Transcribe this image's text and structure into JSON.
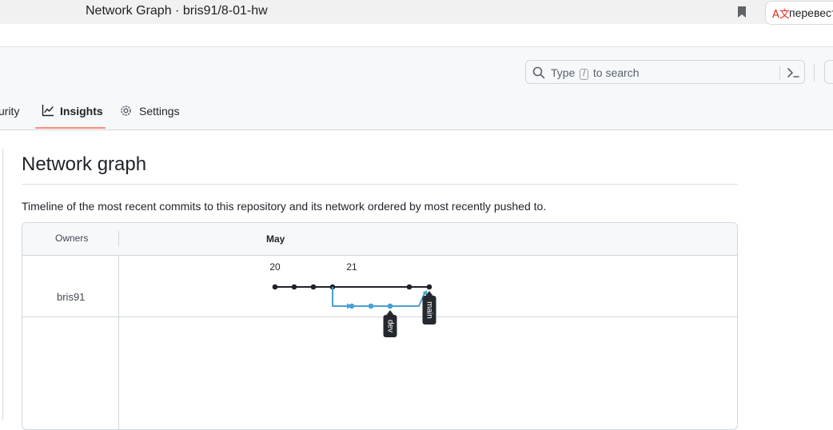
{
  "browser": {
    "tab_title": "Network Graph · bris91/8-01-hw",
    "translate_label": "перевест",
    "translate_icon": "translate-icon"
  },
  "header": {
    "search_prefix": "Type",
    "search_key": "/",
    "search_suffix": "to search",
    "command_icon": "terminal-icon"
  },
  "nav": {
    "security_label": "urity",
    "insights_label": "Insights",
    "settings_label": "Settings",
    "accent_color": "#fd8c73"
  },
  "main": {
    "title": "Network graph",
    "description": "Timeline of the most recent commits to this repository and its network ordered by most recently pushed to."
  },
  "graph": {
    "owners_header": "Owners",
    "month": "May",
    "days": [
      "20",
      "21"
    ],
    "owner": "bris91",
    "branches": [
      {
        "name": "main",
        "color": "#1f2328"
      },
      {
        "name": "dev",
        "color": "#4a9fd5"
      }
    ]
  }
}
